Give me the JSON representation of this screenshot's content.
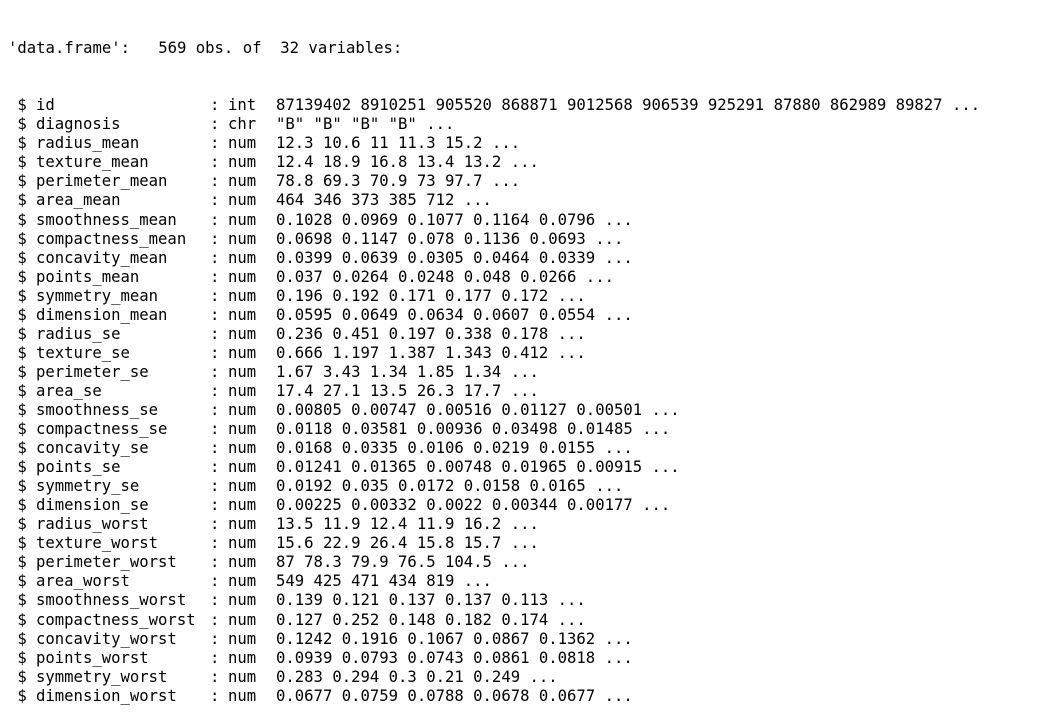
{
  "console": {
    "header": "'data.frame':\t569 obs. of  32 variables:",
    "rows": [
      {
        "name": "id",
        "type": "int",
        "values": "87139402 8910251 905520 868871 9012568 906539 925291 87880 862989 89827 ..."
      },
      {
        "name": "diagnosis",
        "type": "chr",
        "values": "\"B\" \"B\" \"B\" \"B\" ..."
      },
      {
        "name": "radius_mean",
        "type": "num",
        "values": "12.3 10.6 11 11.3 15.2 ..."
      },
      {
        "name": "texture_mean",
        "type": "num",
        "values": "12.4 18.9 16.8 13.4 13.2 ..."
      },
      {
        "name": "perimeter_mean",
        "type": "num",
        "values": "78.8 69.3 70.9 73 97.7 ..."
      },
      {
        "name": "area_mean",
        "type": "num",
        "values": "464 346 373 385 712 ..."
      },
      {
        "name": "smoothness_mean",
        "type": "num",
        "values": "0.1028 0.0969 0.1077 0.1164 0.0796 ..."
      },
      {
        "name": "compactness_mean",
        "type": "num",
        "values": "0.0698 0.1147 0.078 0.1136 0.0693 ..."
      },
      {
        "name": "concavity_mean",
        "type": "num",
        "values": "0.0399 0.0639 0.0305 0.0464 0.0339 ..."
      },
      {
        "name": "points_mean",
        "type": "num",
        "values": "0.037 0.0264 0.0248 0.048 0.0266 ..."
      },
      {
        "name": "symmetry_mean",
        "type": "num",
        "values": "0.196 0.192 0.171 0.177 0.172 ..."
      },
      {
        "name": "dimension_mean",
        "type": "num",
        "values": "0.0595 0.0649 0.0634 0.0607 0.0554 ..."
      },
      {
        "name": "radius_se",
        "type": "num",
        "values": "0.236 0.451 0.197 0.338 0.178 ..."
      },
      {
        "name": "texture_se",
        "type": "num",
        "values": "0.666 1.197 1.387 1.343 0.412 ..."
      },
      {
        "name": "perimeter_se",
        "type": "num",
        "values": "1.67 3.43 1.34 1.85 1.34 ..."
      },
      {
        "name": "area_se",
        "type": "num",
        "values": "17.4 27.1 13.5 26.3 17.7 ..."
      },
      {
        "name": "smoothness_se",
        "type": "num",
        "values": "0.00805 0.00747 0.00516 0.01127 0.00501 ..."
      },
      {
        "name": "compactness_se",
        "type": "num",
        "values": "0.0118 0.03581 0.00936 0.03498 0.01485 ..."
      },
      {
        "name": "concavity_se",
        "type": "num",
        "values": "0.0168 0.0335 0.0106 0.0219 0.0155 ..."
      },
      {
        "name": "points_se",
        "type": "num",
        "values": "0.01241 0.01365 0.00748 0.01965 0.00915 ..."
      },
      {
        "name": "symmetry_se",
        "type": "num",
        "values": "0.0192 0.035 0.0172 0.0158 0.0165 ..."
      },
      {
        "name": "dimension_se",
        "type": "num",
        "values": "0.00225 0.00332 0.0022 0.00344 0.00177 ..."
      },
      {
        "name": "radius_worst",
        "type": "num",
        "values": "13.5 11.9 12.4 11.9 16.2 ..."
      },
      {
        "name": "texture_worst",
        "type": "num",
        "values": "15.6 22.9 26.4 15.8 15.7 ..."
      },
      {
        "name": "perimeter_worst",
        "type": "num",
        "values": "87 78.3 79.9 76.5 104.5 ..."
      },
      {
        "name": "area_worst",
        "type": "num",
        "values": "549 425 471 434 819 ..."
      },
      {
        "name": "smoothness_worst",
        "type": "num",
        "values": "0.139 0.121 0.137 0.137 0.113 ..."
      },
      {
        "name": "compactness_worst",
        "type": "num",
        "values": "0.127 0.252 0.148 0.182 0.174 ..."
      },
      {
        "name": "concavity_worst",
        "type": "num",
        "values": "0.1242 0.1916 0.1067 0.0867 0.1362 ..."
      },
      {
        "name": "points_worst",
        "type": "num",
        "values": "0.0939 0.0793 0.0743 0.0861 0.0818 ..."
      },
      {
        "name": "symmetry_worst",
        "type": "num",
        "values": "0.283 0.294 0.3 0.21 0.249 ..."
      },
      {
        "name": "dimension_worst",
        "type": "num",
        "values": "0.0677 0.0759 0.0788 0.0678 0.0677 ..."
      }
    ]
  }
}
